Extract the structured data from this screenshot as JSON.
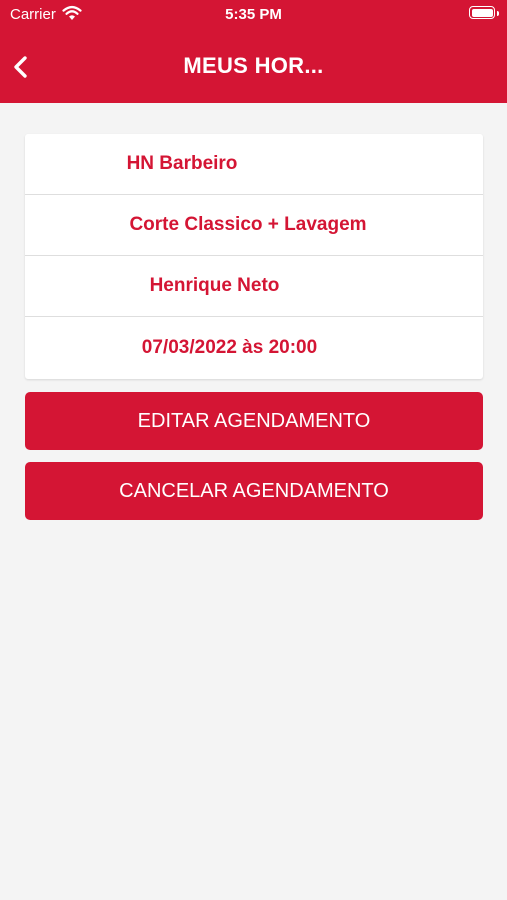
{
  "status": {
    "carrier": "Carrier",
    "time": "5:35 PM",
    "icons": [
      "wifi-icon",
      "battery-icon"
    ]
  },
  "nav": {
    "title": "MEUS HOR...",
    "back_icon": "chevron-left-icon"
  },
  "appointment": {
    "barbershop": "HN Barbeiro",
    "service": "Corte Classico + Lavagem",
    "professional": "Henrique Neto",
    "datetime": "07/03/2022 às 20:00"
  },
  "actions": {
    "edit_label": "EDITAR AGENDAMENTO",
    "cancel_label": "CANCELAR AGENDAMENTO"
  },
  "colors": {
    "accent": "#d41534",
    "background": "#f4f4f4",
    "card": "#ffffff"
  }
}
